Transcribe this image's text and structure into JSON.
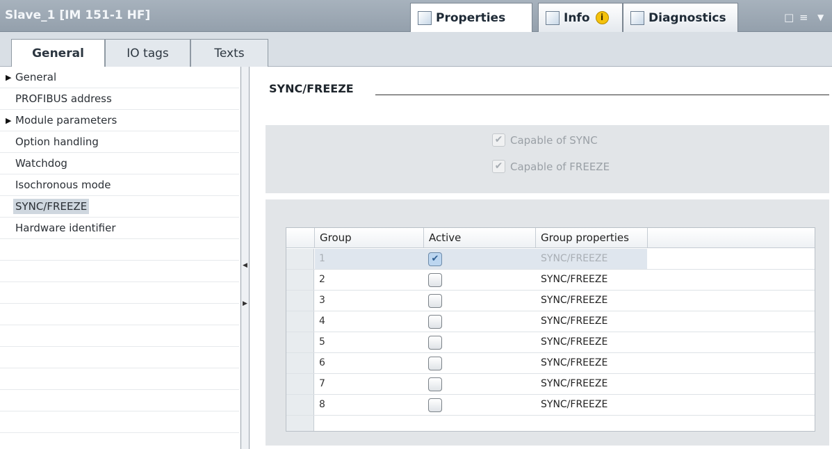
{
  "window": {
    "title": "Slave_1 [IM 151-1 HF]"
  },
  "header_tabs": [
    {
      "label": "Properties",
      "active": true
    },
    {
      "label": "Info",
      "active": false
    },
    {
      "label": "Diagnostics",
      "active": false
    }
  ],
  "window_controls": [
    "restore-icon",
    "menu-icon",
    "dropdown-icon"
  ],
  "property_tabs": [
    {
      "label": "General",
      "active": true
    },
    {
      "label": "IO tags",
      "active": false
    },
    {
      "label": "Texts",
      "active": false
    }
  ],
  "nav": {
    "items": [
      {
        "label": "General",
        "expandable": true,
        "selected": false
      },
      {
        "label": "PROFIBUS address",
        "expandable": false,
        "selected": false
      },
      {
        "label": "Module parameters",
        "expandable": true,
        "selected": false
      },
      {
        "label": "Option handling",
        "expandable": false,
        "selected": false
      },
      {
        "label": "Watchdog",
        "expandable": false,
        "selected": false
      },
      {
        "label": "Isochronous mode",
        "expandable": false,
        "selected": false
      },
      {
        "label": "SYNC/FREEZE",
        "expandable": false,
        "selected": true
      },
      {
        "label": "Hardware identifier",
        "expandable": false,
        "selected": false
      }
    ]
  },
  "section": {
    "title": "SYNC/FREEZE",
    "capabilities": [
      {
        "label": "Capable of SYNC",
        "checked": true,
        "disabled": true
      },
      {
        "label": "Capable of FREEZE",
        "checked": true,
        "disabled": true
      }
    ]
  },
  "table": {
    "headers": [
      "Group",
      "Active",
      "Group properties"
    ],
    "rows": [
      {
        "group": "1",
        "active": true,
        "properties": "SYNC/FREEZE"
      },
      {
        "group": "2",
        "active": false,
        "properties": "SYNC/FREEZE"
      },
      {
        "group": "3",
        "active": false,
        "properties": "SYNC/FREEZE"
      },
      {
        "group": "4",
        "active": false,
        "properties": "SYNC/FREEZE"
      },
      {
        "group": "5",
        "active": false,
        "properties": "SYNC/FREEZE"
      },
      {
        "group": "6",
        "active": false,
        "properties": "SYNC/FREEZE"
      },
      {
        "group": "7",
        "active": false,
        "properties": "SYNC/FREEZE"
      },
      {
        "group": "8",
        "active": false,
        "properties": "SYNC/FREEZE"
      }
    ]
  },
  "icons": {
    "check": "✔",
    "expand": "▶",
    "info_badge": "i"
  }
}
